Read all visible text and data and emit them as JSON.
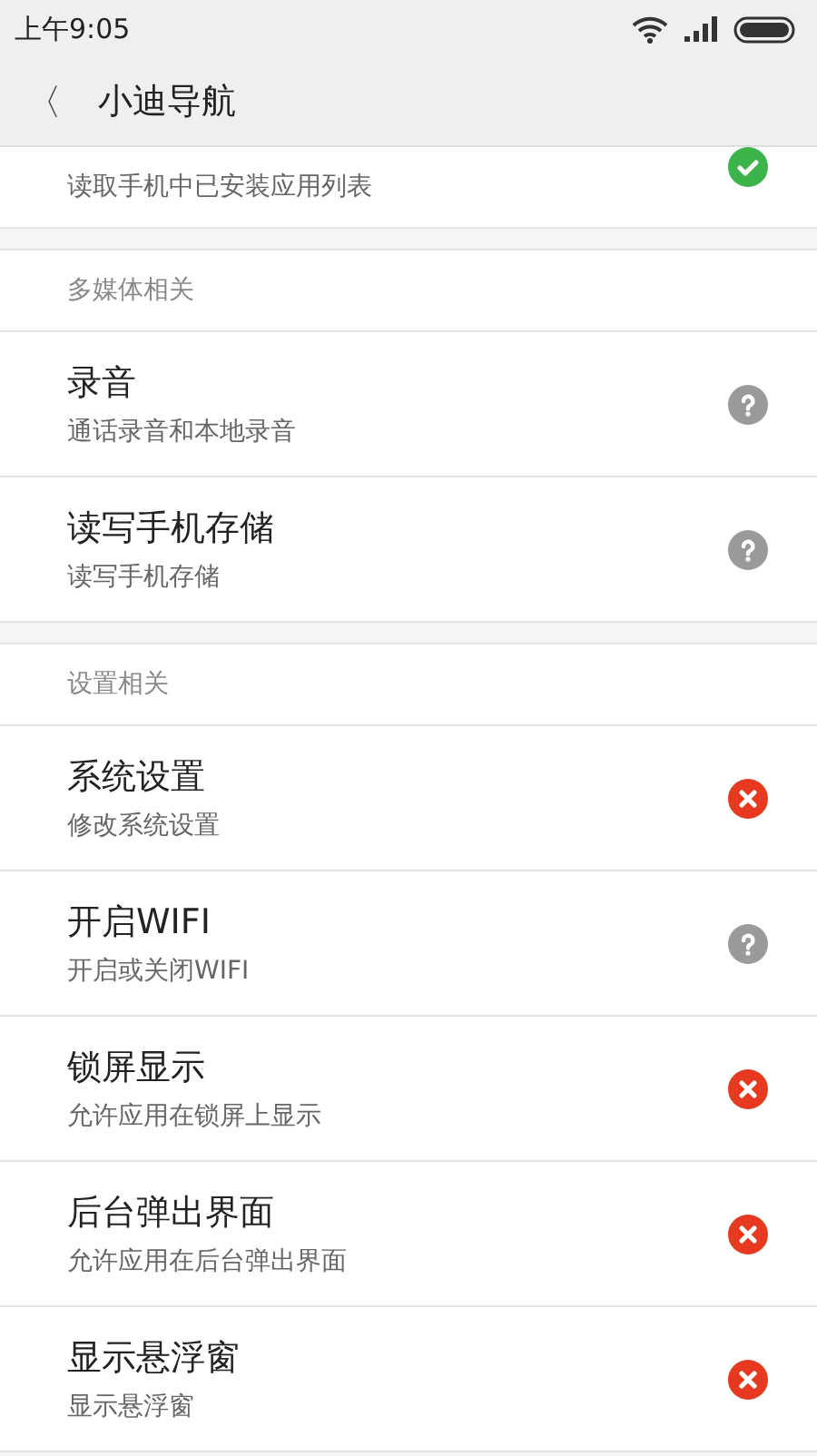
{
  "status_bar": {
    "time": "上午9:05"
  },
  "header": {
    "back": "〈",
    "title": "小迪导航"
  },
  "sections": [
    {
      "items": [
        {
          "subtitle": "读取手机中已安装应用列表",
          "kind": "allowed"
        }
      ]
    },
    {
      "heading": "多媒体相关",
      "items": [
        {
          "title": "录音",
          "subtitle": "通话录音和本地录音",
          "kind": "unknown"
        },
        {
          "title": "读写手机存储",
          "subtitle": "读写手机存储",
          "kind": "unknown"
        }
      ]
    },
    {
      "heading": "设置相关",
      "items": [
        {
          "title": "系统设置",
          "subtitle": "修改系统设置",
          "kind": "denied"
        },
        {
          "title": "开启WIFI",
          "subtitle": "开启或关闭WIFI",
          "kind": "unknown"
        },
        {
          "title": "锁屏显示",
          "subtitle": "允许应用在锁屏上显示",
          "kind": "denied"
        },
        {
          "title": "后台弹出界面",
          "subtitle": "允许应用在后台弹出界面",
          "kind": "denied"
        },
        {
          "title": "显示悬浮窗",
          "subtitle": "显示悬浮窗",
          "kind": "denied"
        }
      ]
    }
  ]
}
